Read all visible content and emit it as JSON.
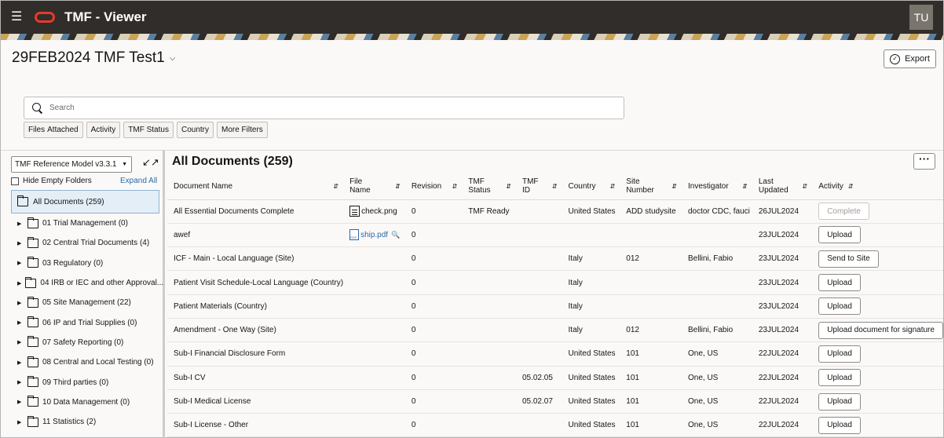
{
  "header": {
    "app_title": "TMF - Viewer",
    "avatar_initials": "TU",
    "logo_color": "#e43b2c"
  },
  "page": {
    "title": "29FEB2024 TMF Test1",
    "export_label": "Export"
  },
  "search": {
    "placeholder": "Search"
  },
  "filters": {
    "files_label": "Files",
    "files_value": "Attached",
    "activity": "Activity",
    "tmf_status": "TMF Status",
    "country": "Country",
    "more_filters": "More Filters"
  },
  "sidebar": {
    "model": "TMF Reference Model v3.3.1",
    "hide_empty": "Hide Empty Folders",
    "expand_all": "Expand All",
    "root": "All Documents (259)",
    "items": [
      "01 Trial Management (0)",
      "02 Central Trial Documents (4)",
      "03 Regulatory (0)",
      "04 IRB or IEC and other Approval...",
      "05 Site Management (22)",
      "06 IP and Trial Supplies (0)",
      "07 Safety Reporting (0)",
      "08 Central and Local Testing (0)",
      "09 Third parties (0)",
      "10 Data Management (0)",
      "11 Statistics (2)"
    ]
  },
  "main": {
    "title": "All Documents (259)",
    "columns": {
      "document_name": "Document Name",
      "file_name_1": "File",
      "file_name_2": "Name",
      "revision": "Revision",
      "tmf_status_1": "TMF",
      "tmf_status_2": "Status",
      "tmf_id_1": "TMF",
      "tmf_id_2": "ID",
      "country": "Country",
      "site_number_1": "Site",
      "site_number_2": "Number",
      "investigator": "Investigator",
      "last_updated_1": "Last",
      "last_updated_2": "Updated",
      "activity": "Activity"
    },
    "rows": [
      {
        "name": "All Essential Documents Complete",
        "file": "check.png",
        "file_type": "doc",
        "revision": "0",
        "status": "TMF Ready",
        "tmf_id": "",
        "country": "United States",
        "site": "ADD studysite",
        "investigator": "doctor CDC, fauci",
        "updated": "26JUL2024",
        "activity": "Complete",
        "activity_disabled": true
      },
      {
        "name": "awef",
        "file": "ship.pdf",
        "file_type": "pdf",
        "revision": "0",
        "status": "",
        "tmf_id": "",
        "country": "",
        "site": "",
        "investigator": "",
        "updated": "23JUL2024",
        "activity": "Upload",
        "activity_disabled": false
      },
      {
        "name": "ICF - Main - Local Language (Site)",
        "file": "",
        "file_type": "",
        "revision": "0",
        "status": "",
        "tmf_id": "",
        "country": "Italy",
        "site": "012",
        "investigator": "Bellini, Fabio",
        "updated": "23JUL2024",
        "activity": "Send to Site",
        "activity_disabled": false
      },
      {
        "name": "Patient Visit Schedule-Local Language (Country)",
        "file": "",
        "file_type": "",
        "revision": "0",
        "status": "",
        "tmf_id": "",
        "country": "Italy",
        "site": "",
        "investigator": "",
        "updated": "23JUL2024",
        "activity": "Upload",
        "activity_disabled": false
      },
      {
        "name": "Patient Materials (Country)",
        "file": "",
        "file_type": "",
        "revision": "0",
        "status": "",
        "tmf_id": "",
        "country": "Italy",
        "site": "",
        "investigator": "",
        "updated": "23JUL2024",
        "activity": "Upload",
        "activity_disabled": false
      },
      {
        "name": "Amendment - One Way (Site)",
        "file": "",
        "file_type": "",
        "revision": "0",
        "status": "",
        "tmf_id": "",
        "country": "Italy",
        "site": "012",
        "investigator": "Bellini, Fabio",
        "updated": "23JUL2024",
        "activity": "Upload document for signature",
        "activity_disabled": false
      },
      {
        "name": "Sub-I Financial Disclosure Form",
        "file": "",
        "file_type": "",
        "revision": "0",
        "status": "",
        "tmf_id": "",
        "country": "United States",
        "site": "101",
        "investigator": "One, US",
        "updated": "22JUL2024",
        "activity": "Upload",
        "activity_disabled": false
      },
      {
        "name": "Sub-I CV",
        "file": "",
        "file_type": "",
        "revision": "0",
        "status": "",
        "tmf_id": "05.02.05",
        "country": "United States",
        "site": "101",
        "investigator": "One, US",
        "updated": "22JUL2024",
        "activity": "Upload",
        "activity_disabled": false
      },
      {
        "name": "Sub-I Medical License",
        "file": "",
        "file_type": "",
        "revision": "0",
        "status": "",
        "tmf_id": "05.02.07",
        "country": "United States",
        "site": "101",
        "investigator": "One, US",
        "updated": "22JUL2024",
        "activity": "Upload",
        "activity_disabled": false
      },
      {
        "name": "Sub-I License - Other",
        "file": "",
        "file_type": "",
        "revision": "0",
        "status": "",
        "tmf_id": "",
        "country": "United States",
        "site": "101",
        "investigator": "One, US",
        "updated": "22JUL2024",
        "activity": "Upload",
        "activity_disabled": false
      }
    ]
  }
}
